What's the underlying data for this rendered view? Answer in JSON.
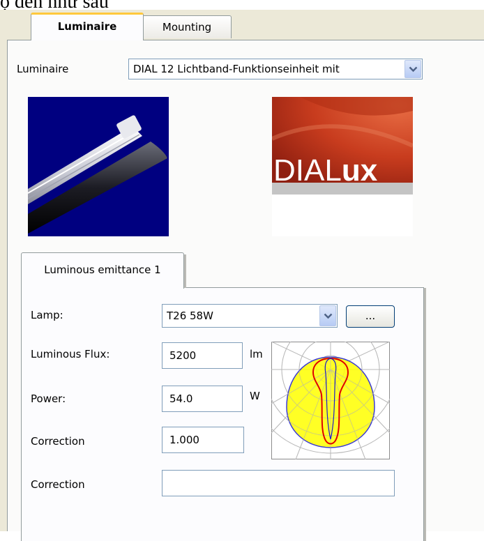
{
  "caption": "ộ đèn như sau",
  "tabs": {
    "luminaire": "Luminaire",
    "mounting": "Mounting"
  },
  "luminaire": {
    "label": "Luminaire",
    "selected": "DIAL 12 Lichtband-Funktionseinheit mit"
  },
  "logo": {
    "brand_light": "DIAL",
    "brand_bold": "ux"
  },
  "emittance": {
    "tab_label": "Luminous emittance 1",
    "lamp_label": "Lamp:",
    "lamp_value": "T26 58W",
    "browse_label": "...",
    "flux_label": "Luminous Flux:",
    "flux_value": "5200",
    "flux_unit": "lm",
    "power_label": "Power:",
    "power_value": "54.0",
    "power_unit": "W",
    "correction1_label": "Correction",
    "correction1_value": "1.000",
    "correction2_label": "Correction",
    "correction2_value": ""
  },
  "colors": {
    "window_bg": "#ece9d8",
    "tab_highlight": "#ffc83c",
    "photo_bg": "#000080",
    "logo_red": "#c83c1e",
    "curve_fill": "#ffff00",
    "curve_red": "#e00000",
    "curve_blue": "#1a1acc"
  },
  "icons": {
    "dropdown": "chevron-down-icon",
    "photometric": "polar-curve-icon"
  }
}
